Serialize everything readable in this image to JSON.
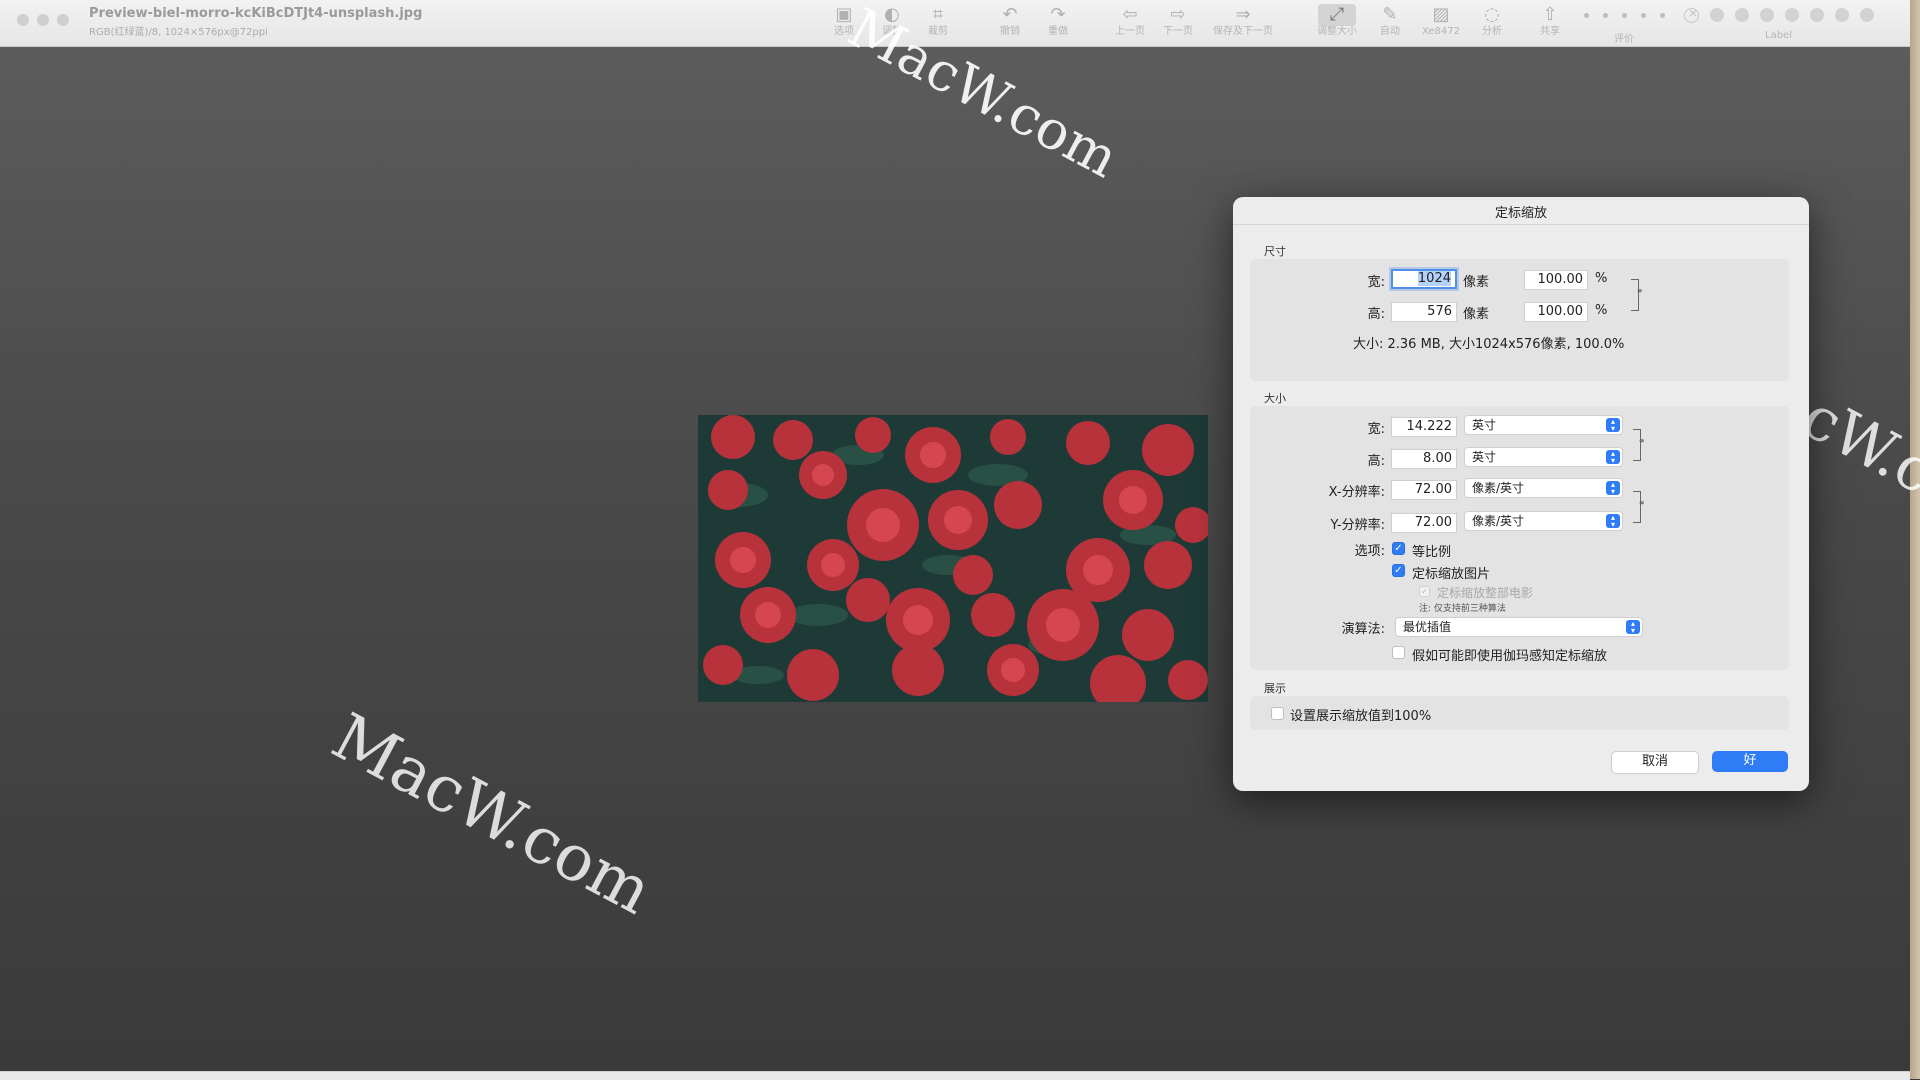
{
  "window": {
    "doc_title": "Preview-biel-morro-kcKiBcDTJt4-unsplash.jpg",
    "doc_subtitle": "RGB(红绿蓝)/8, 1024×576px@72ppi"
  },
  "toolbar": {
    "options": "选项",
    "adjust": "调整",
    "crop": "裁剪",
    "undo": "撤销",
    "redo": "重做",
    "prev": "上一页",
    "next": "下一页",
    "save_next": "保存及下一页",
    "resize": "调整大小",
    "auto": "自动",
    "xe": "Xe8472",
    "analyze": "分析",
    "share": "共享",
    "rating": "评价",
    "label": "Label"
  },
  "watermarks": {
    "text": "MacW.com"
  },
  "dialog": {
    "title": "定标缩放",
    "dimensions_caption": "尺寸",
    "width_label": "宽:",
    "height_label": "高:",
    "width_px": "1024",
    "height_px": "576",
    "px_unit": "像素",
    "width_pct": "100.00",
    "height_pct": "100.00",
    "pct_unit": "%",
    "size_info": "大小:  2.36 MB, 大小1024x576像素, 100.0%",
    "size_caption": "大小",
    "size_width": "14.222",
    "size_height": "8.00",
    "inch_unit": "英寸",
    "xres_label": "X-分辨率:",
    "yres_label": "Y-分辨率:",
    "xres": "72.00",
    "yres": "72.00",
    "res_unit": "像素/英寸",
    "options_label": "选项:",
    "opt_proportional": "等比例",
    "opt_scale_image": "定标缩放图片",
    "opt_scale_movie": "定标缩放整部电影",
    "opt_note": "注:  仅支持前三种算法",
    "algorithm_label": "演算法:",
    "algorithm_value": "最优插值",
    "opt_gamma": "假如可能即使用伽玛感知定标缩放",
    "display_caption": "展示",
    "opt_display_100": "设置展示缩放值到100%",
    "cancel": "取消",
    "ok": "好"
  }
}
